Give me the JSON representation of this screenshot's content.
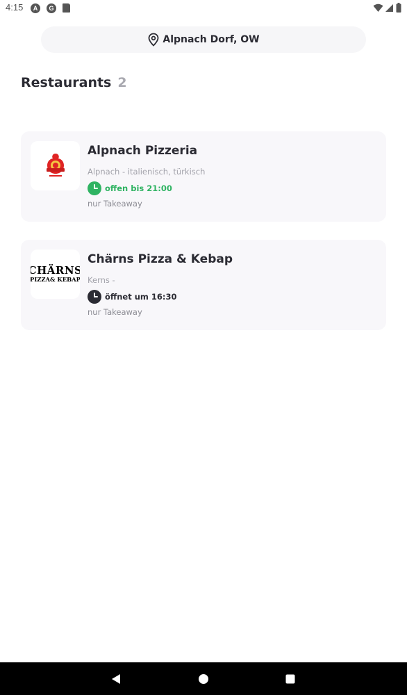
{
  "status_bar": {
    "time": "4:15",
    "icons": [
      "android-notification-icon",
      "google-photos-icon",
      "sd-card-icon",
      "wifi-icon",
      "signal-icon",
      "battery-icon"
    ]
  },
  "location": {
    "label": "Alpnach Dorf, OW",
    "icon": "location-pin-icon"
  },
  "section": {
    "title": "Restaurants",
    "count": "2"
  },
  "restaurants": [
    {
      "name": "Alpnach Pizzeria",
      "meta": "Alpnach - italienisch, türkisch",
      "status": "offen bis 21:00",
      "status_color": "#2fb362",
      "type": "nur Takeaway",
      "logo": "alpnach-pizzeria-logo-icon"
    },
    {
      "name": "Chärns Pizza & Kebap",
      "meta": "Kerns -",
      "status": "öffnet um 16:30",
      "status_color": "#2b2b33",
      "type": "nur Takeaway",
      "logo_text_top": "CHÄRNS",
      "logo_text_bottom": "PIZZA& KEBAP"
    }
  ],
  "nav_bar": {
    "buttons": [
      "back-icon",
      "home-icon",
      "recents-icon"
    ]
  },
  "colors": {
    "open": "#2fb362",
    "closed": "#2b2b33",
    "card_bg": "#f8f7fa",
    "pill_bg": "#f6f6f8",
    "muted": "#a2a2aa"
  }
}
